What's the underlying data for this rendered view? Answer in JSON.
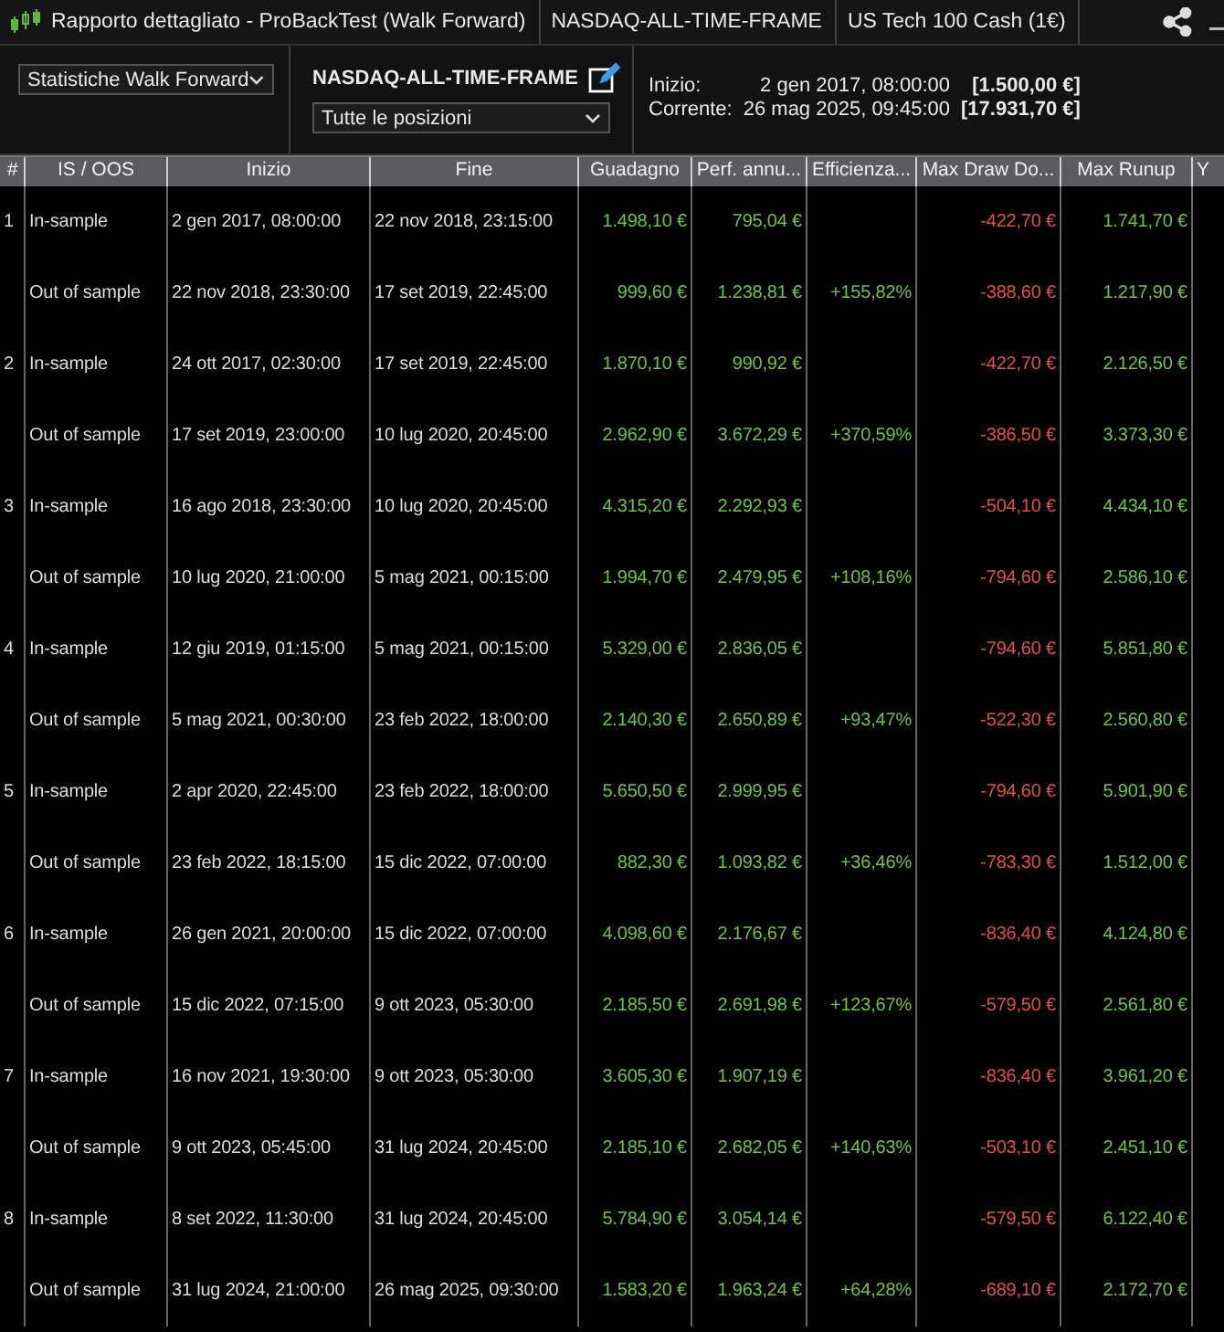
{
  "window": {
    "title_segments": [
      "Rapporto dettagliato - ProBackTest (Walk Forward)",
      "NASDAQ-ALL-TIME-FRAME",
      "US Tech 100 Cash (1€)"
    ]
  },
  "toolbar": {
    "view_select": "Statistiche Walk Forward",
    "strategy_name": "NASDAQ-ALL-TIME-FRAME",
    "positions_select": "Tutte le posizioni",
    "info": [
      {
        "label": "Inizio:",
        "date": "2 gen 2017, 08:00:00",
        "amount": "[1.500,00 €]"
      },
      {
        "label": "Corrente:",
        "date": "26 mag 2025, 09:45:00",
        "amount": "[17.931,70 €]"
      }
    ]
  },
  "table": {
    "columns": [
      {
        "label": "#",
        "kind": "text"
      },
      {
        "label": "IS / OOS",
        "kind": "text"
      },
      {
        "label": "Inizio",
        "kind": "text"
      },
      {
        "label": "Fine",
        "kind": "text"
      },
      {
        "label": "Guadagno",
        "kind": "gain"
      },
      {
        "label": "Perf. annu...",
        "kind": "gain"
      },
      {
        "label": "Efficienza...",
        "kind": "gain"
      },
      {
        "label": "Max Draw Do...",
        "kind": "loss"
      },
      {
        "label": "Max Runup",
        "kind": "gain"
      },
      {
        "label": "Y",
        "kind": "text"
      }
    ],
    "rows": [
      {
        "cells": [
          "1",
          "In-sample",
          "2 gen 2017, 08:00:00",
          "22 nov 2018, 23:15:00",
          "1.498,10 €",
          "795,04 €",
          null,
          "-422,70 €",
          "1.741,70 €"
        ]
      },
      {
        "cells": [
          null,
          "Out of sample",
          "22 nov 2018, 23:30:00",
          "17 set 2019, 22:45:00",
          "999,60 €",
          "1.238,81 €",
          "+155,82%",
          "-388,60 €",
          "1.217,90 €"
        ]
      },
      {
        "cells": [
          "2",
          "In-sample",
          "24 ott 2017, 02:30:00",
          "17 set 2019, 22:45:00",
          "1.870,10 €",
          "990,92 €",
          null,
          "-422,70 €",
          "2.126,50 €"
        ]
      },
      {
        "cells": [
          null,
          "Out of sample",
          "17 set 2019, 23:00:00",
          "10 lug 2020, 20:45:00",
          "2.962,90 €",
          "3.672,29 €",
          "+370,59%",
          "-386,50 €",
          "3.373,30 €"
        ]
      },
      {
        "cells": [
          "3",
          "In-sample",
          "16 ago 2018, 23:30:00",
          "10 lug 2020, 20:45:00",
          "4.315,20 €",
          "2.292,93 €",
          null,
          "-504,10 €",
          "4.434,10 €"
        ]
      },
      {
        "cells": [
          null,
          "Out of sample",
          "10 lug 2020, 21:00:00",
          "5 mag 2021, 00:15:00",
          "1.994,70 €",
          "2.479,95 €",
          "+108,16%",
          "-794,60 €",
          "2.586,10 €"
        ]
      },
      {
        "cells": [
          "4",
          "In-sample",
          "12 giu 2019, 01:15:00",
          "5 mag 2021, 00:15:00",
          "5.329,00 €",
          "2.836,05 €",
          null,
          "-794,60 €",
          "5.851,80 €"
        ]
      },
      {
        "cells": [
          null,
          "Out of sample",
          "5 mag 2021, 00:30:00",
          "23 feb 2022, 18:00:00",
          "2.140,30 €",
          "2.650,89 €",
          "+93,47%",
          "-522,30 €",
          "2.560,80 €"
        ]
      },
      {
        "cells": [
          "5",
          "In-sample",
          "2 apr 2020, 22:45:00",
          "23 feb 2022, 18:00:00",
          "5.650,50 €",
          "2.999,95 €",
          null,
          "-794,60 €",
          "5.901,90 €"
        ]
      },
      {
        "cells": [
          null,
          "Out of sample",
          "23 feb 2022, 18:15:00",
          "15 dic 2022, 07:00:00",
          "882,30 €",
          "1.093,82 €",
          "+36,46%",
          "-783,30 €",
          "1.512,00 €"
        ]
      },
      {
        "cells": [
          "6",
          "In-sample",
          "26 gen 2021, 20:00:00",
          "15 dic 2022, 07:00:00",
          "4.098,60 €",
          "2.176,67 €",
          null,
          "-836,40 €",
          "4.124,80 €"
        ]
      },
      {
        "cells": [
          null,
          "Out of sample",
          "15 dic 2022, 07:15:00",
          "9 ott 2023, 05:30:00",
          "2.185,50 €",
          "2.691,98 €",
          "+123,67%",
          "-579,50 €",
          "2.561,80 €"
        ]
      },
      {
        "cells": [
          "7",
          "In-sample",
          "16 nov 2021, 19:30:00",
          "9 ott 2023, 05:30:00",
          "3.605,30 €",
          "1.907,19 €",
          null,
          "-836,40 €",
          "3.961,20 €"
        ]
      },
      {
        "cells": [
          null,
          "Out of sample",
          "9 ott 2023, 05:45:00",
          "31 lug 2024, 20:45:00",
          "2.185,10 €",
          "2.682,05 €",
          "+140,63%",
          "-503,10 €",
          "2.451,10 €"
        ]
      },
      {
        "cells": [
          "8",
          "In-sample",
          "8 set 2022, 11:30:00",
          "31 lug 2024, 20:45:00",
          "5.784,90 €",
          "3.054,14 €",
          null,
          "-579,50 €",
          "6.122,40 €"
        ]
      },
      {
        "cells": [
          null,
          "Out of sample",
          "31 lug 2024, 21:00:00",
          "26 mag 2025, 09:30:00",
          "1.583,20 €",
          "1.963,24 €",
          "+64,28%",
          "-689,10 €",
          "2.172,70 €"
        ]
      }
    ]
  }
}
